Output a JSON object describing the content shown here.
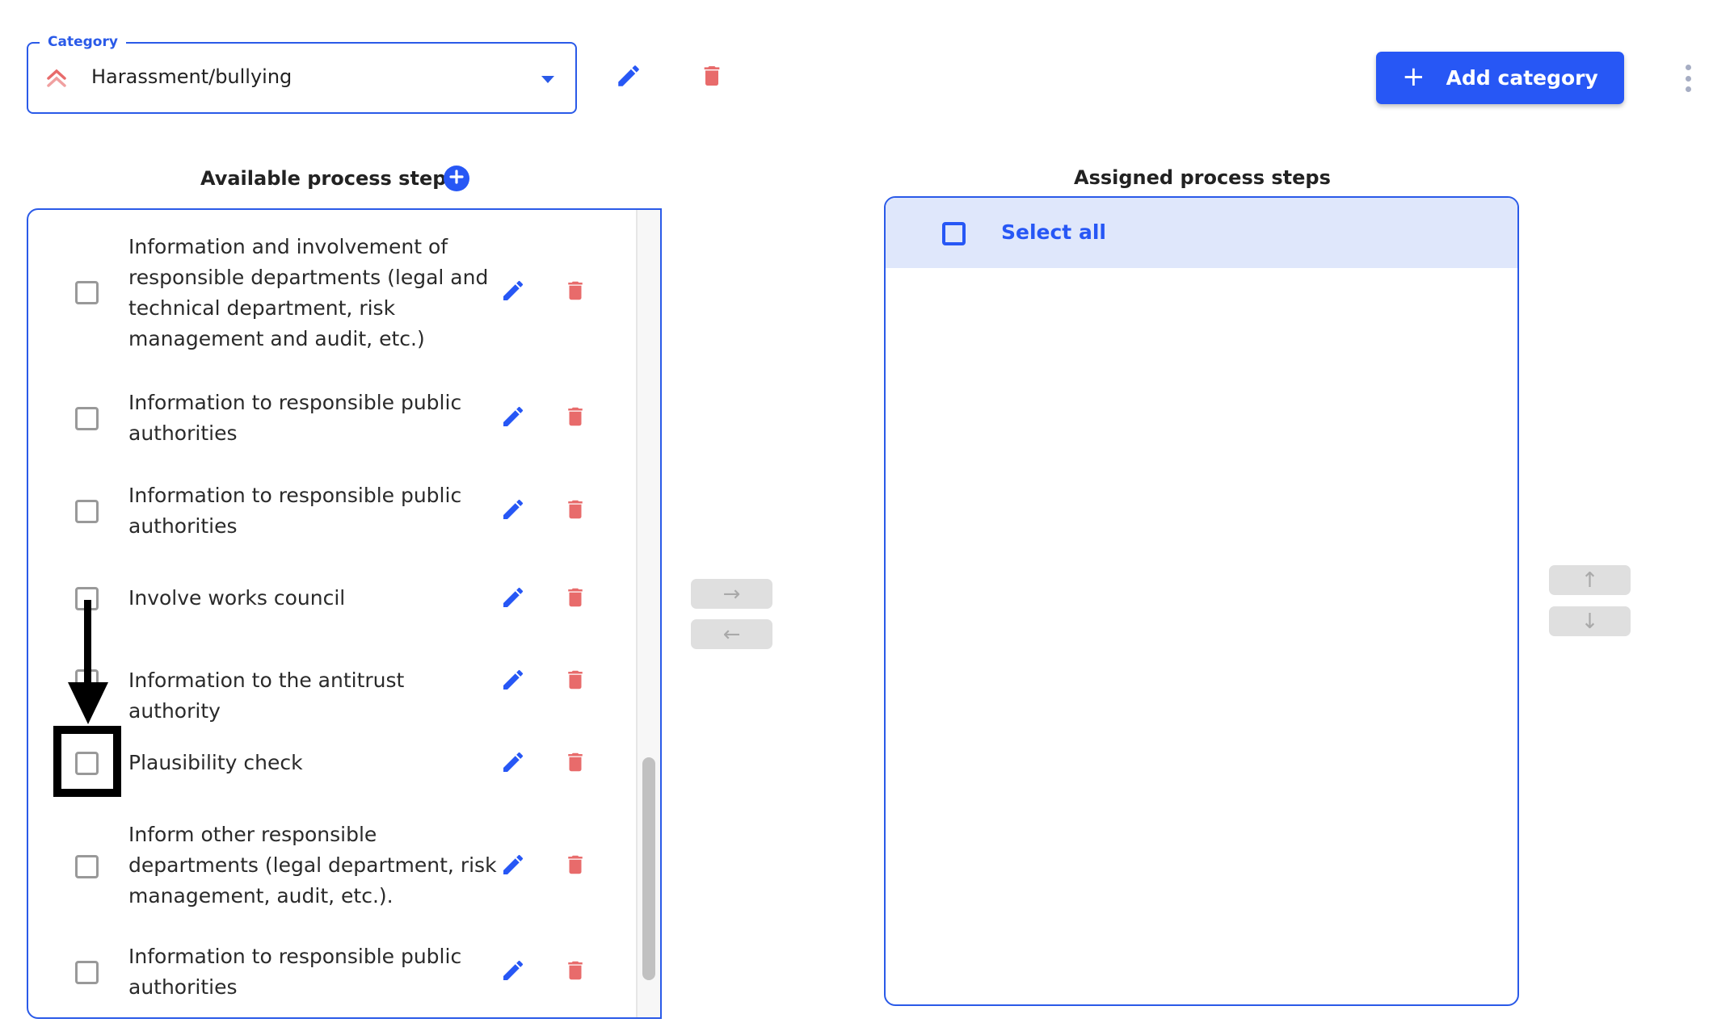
{
  "category": {
    "label": "Category",
    "value": "Harassment/bullying",
    "priority_icon": "double-chevron-up-icon",
    "priority_color": "#e86b6b"
  },
  "toolbar": {
    "edit_icon": "pencil-icon",
    "delete_icon": "trash-icon",
    "add_category_label": "Add category",
    "add_category_icon": "+",
    "more_icon": "kebab-menu-icon"
  },
  "available": {
    "title": "Available process steps",
    "add_icon": "plus-circle-icon",
    "items": [
      {
        "label": "Information and involvement of responsible departments (legal and technical department, risk management and audit, etc.)",
        "checked": false
      },
      {
        "label": "Information to responsible public authorities",
        "checked": false
      },
      {
        "label": "Information to responsible public authorities",
        "checked": false
      },
      {
        "label": "Involve works council",
        "checked": false
      },
      {
        "label": "Information to the antitrust authority",
        "checked": false
      },
      {
        "label": "Plausibility check",
        "checked": false
      },
      {
        "label": "Inform other responsible departments (legal department, risk management, audit, etc.).",
        "checked": false
      },
      {
        "label": "Information to responsible public authorities",
        "checked": false
      }
    ]
  },
  "assigned": {
    "title": "Assigned process steps",
    "select_all_label": "Select all",
    "items": []
  },
  "transfer": {
    "move_right": "→",
    "move_left": "←",
    "move_up": "↑",
    "move_down": "↓"
  },
  "colors": {
    "accent": "#2757f5",
    "danger": "#e86b6b",
    "disabled": "#dfdfdf"
  }
}
